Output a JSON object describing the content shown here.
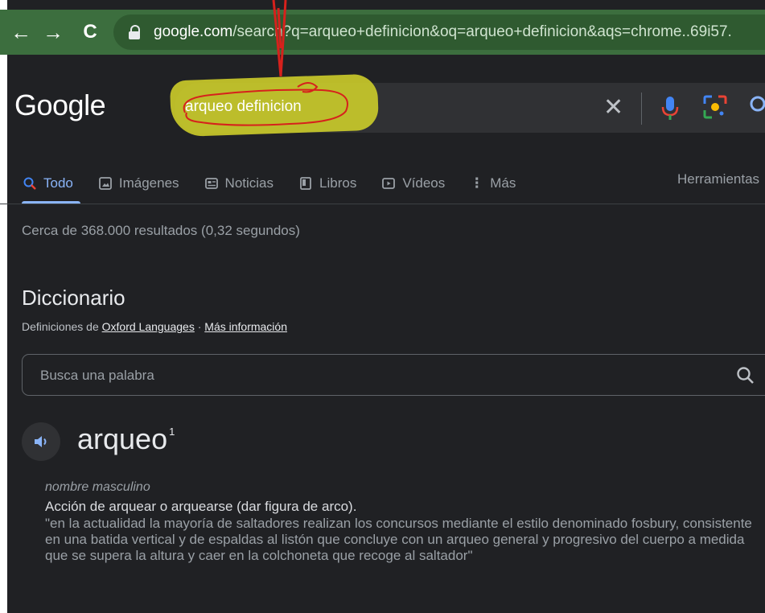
{
  "browser": {
    "url_host": "google.com",
    "url_path": "/search?q=arqueo+definicion&oq=arqueo+definicion&aqs=chrome..69i57."
  },
  "header": {
    "logo": "Google",
    "query": "arqueo definicion"
  },
  "tabs": [
    {
      "label": "Todo",
      "icon": "search-icon",
      "active": true
    },
    {
      "label": "Imágenes",
      "icon": "image-icon",
      "active": false
    },
    {
      "label": "Noticias",
      "icon": "news-icon",
      "active": false
    },
    {
      "label": "Libros",
      "icon": "book-icon",
      "active": false
    },
    {
      "label": "Vídeos",
      "icon": "video-icon",
      "active": false
    },
    {
      "label": "Más",
      "icon": "more-vert-icon",
      "active": false
    }
  ],
  "tools_label": "Herramientas",
  "results_stats": "Cerca de 368.000 resultados (0,32 segundos)",
  "dictionary": {
    "title": "Diccionario",
    "source_prefix": "Definiciones de",
    "source_link": "Oxford Languages",
    "separator": "·",
    "more_info": "Más información",
    "search_placeholder": "Busca una palabra",
    "word": "arqueo",
    "superscript": "1",
    "part_of_speech": "nombre masculino",
    "definition": "Acción de arquear o arquearse (dar figura de arco).",
    "example": "\"en la actualidad la mayoría de saltadores realizan los concursos mediante el estilo denominado fosbury, consistente en una batida vertical y de espaldas al listón que concluye con un arqueo general y progresivo del cuerpo a medida que se supera la altura y caer en la colchoneta que recoge al saltador\""
  },
  "colors": {
    "background": "#202124",
    "chrome_bar": "#3c6e3e",
    "accent": "#8ab4f8",
    "highlight": "#c9c92a",
    "annotation": "#d6211c"
  }
}
